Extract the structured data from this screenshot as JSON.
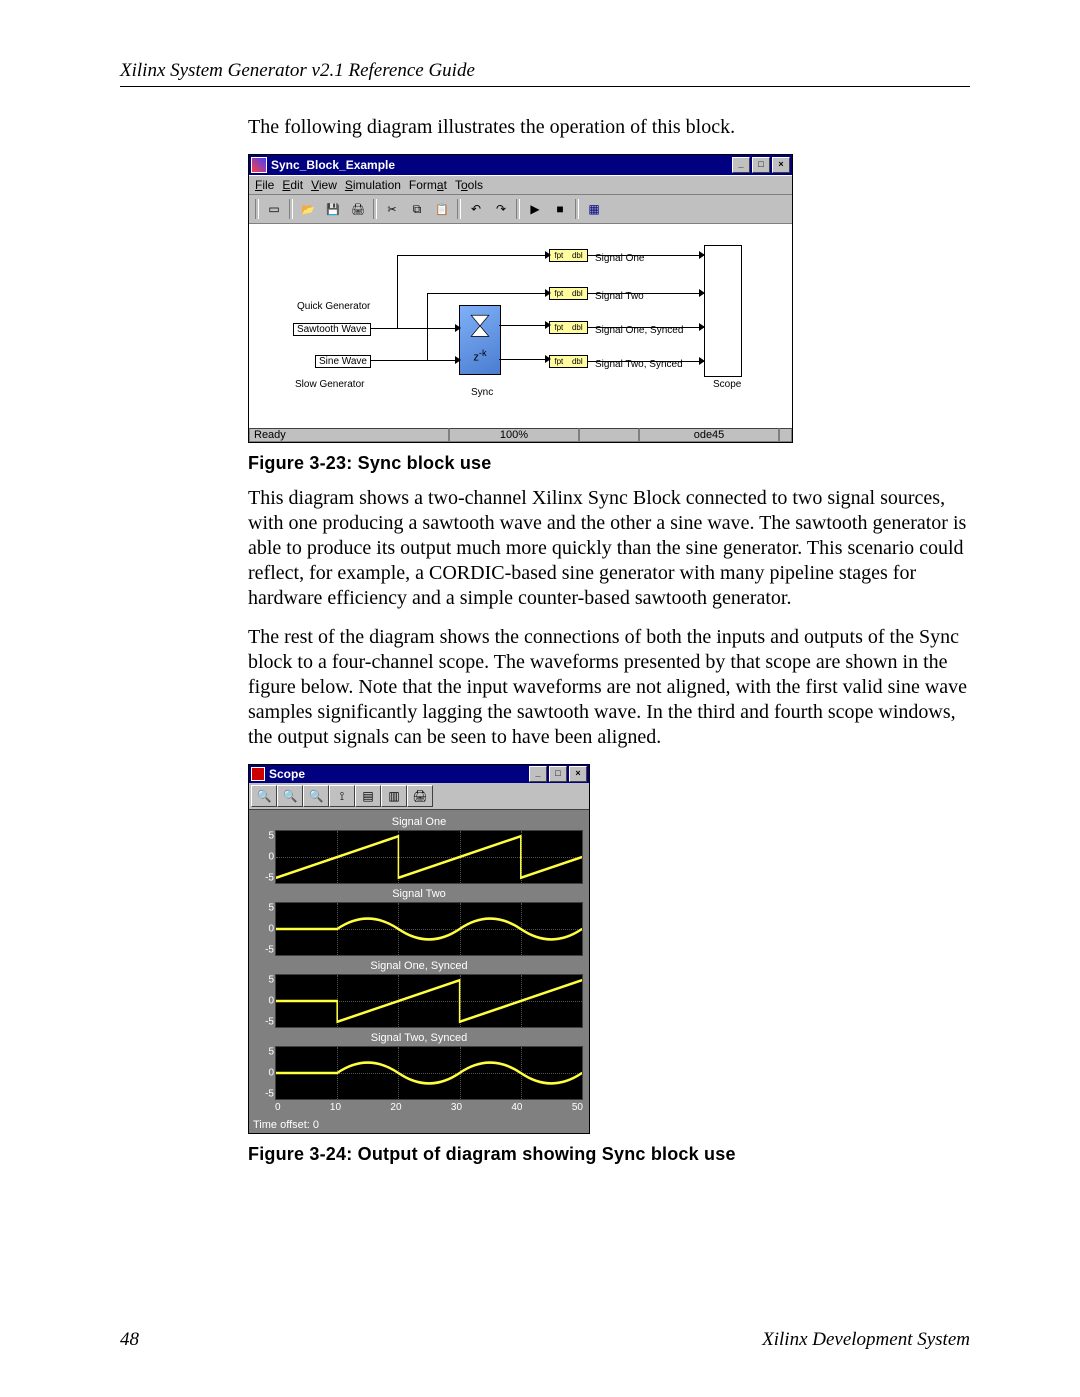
{
  "header": {
    "running_title": "Xilinx System Generator v2.1 Reference Guide"
  },
  "intro_para": "The following diagram illustrates the operation of this block.",
  "sim": {
    "title": "Sync_Block_Example",
    "menus": [
      "File",
      "Edit",
      "View",
      "Simulation",
      "Format",
      "Tools"
    ],
    "labels": {
      "quick_gen": "Quick Generator",
      "sawtooth": "Sawtooth Wave",
      "sine": "Sine Wave",
      "slow_gen": "Slow Generator",
      "sync": "Sync",
      "scope": "Scope",
      "sig1": "Signal One",
      "sig2": "Signal Two",
      "sig1s": "Signal One, Synced",
      "sig2s": "Signal Two, Synced",
      "zk": "z-k",
      "fpt_left": "fpt",
      "fpt_right": "dbl"
    },
    "status": {
      "ready": "Ready",
      "zoom": "100%",
      "solver": "ode45"
    }
  },
  "fig23_caption": "Figure 3-23:   Sync block use",
  "para2": "This diagram shows a two-channel Xilinx Sync Block connected to two signal sources, with one producing a sawtooth wave and the other a sine wave. The sawtooth generator is able to produce its output much more quickly than the sine generator. This scenario could reflect, for example, a CORDIC-based sine generator with many pipeline stages for hardware efficiency and a simple counter-based sawtooth generator.",
  "para3": "The rest of the diagram shows the connections of both the inputs and outputs of the Sync block to a four-channel scope. The waveforms presented by that scope are shown in the figure below. Note that the input waveforms are not aligned, with the first valid sine wave samples significantly lagging the sawtooth wave. In the third and fourth scope windows, the output signals can be seen to have been aligned.",
  "scope": {
    "title": "Scope",
    "plots": [
      "Signal One",
      "Signal Two",
      "Signal One, Synced",
      "Signal Two, Synced"
    ],
    "yticks": [
      "5",
      "0",
      "-5"
    ],
    "xticks": [
      "0",
      "10",
      "20",
      "30",
      "40",
      "50"
    ],
    "time_offset": "Time offset:   0"
  },
  "fig24_caption": "Figure 3-24:   Output of diagram showing Sync block use",
  "footer": {
    "page": "48",
    "system": "Xilinx Development System"
  },
  "chart_data": [
    {
      "type": "line",
      "title": "Signal One",
      "xlabel": "",
      "ylabel": "",
      "x": [
        0,
        5,
        10,
        15,
        20,
        20,
        25,
        30,
        35,
        40,
        40,
        45,
        50
      ],
      "y": [
        -4,
        -2,
        0,
        2,
        4,
        -4,
        -2,
        0,
        2,
        4,
        -4,
        -2,
        0
      ],
      "ylim": [
        -5,
        5
      ],
      "xlim": [
        0,
        50
      ]
    },
    {
      "type": "line",
      "title": "Signal Two",
      "x": [
        0,
        10,
        10,
        15,
        20,
        25,
        30,
        35,
        40,
        45,
        50
      ],
      "y": [
        0,
        0,
        0,
        3,
        0,
        -3,
        0,
        3,
        0,
        -3,
        0
      ],
      "ylim": [
        -5,
        5
      ],
      "xlim": [
        0,
        50
      ],
      "note": "first ~10 units are zero (delayed start), then sine"
    },
    {
      "type": "line",
      "title": "Signal One, Synced",
      "x": [
        0,
        10,
        10,
        15,
        20,
        25,
        30,
        30,
        35,
        40,
        45,
        50,
        50
      ],
      "y": [
        0,
        0,
        -4,
        -2,
        0,
        2,
        4,
        -4,
        -2,
        0,
        2,
        4,
        -4
      ],
      "ylim": [
        -5,
        5
      ],
      "xlim": [
        0,
        50
      ],
      "note": "sawtooth delayed to align with sine"
    },
    {
      "type": "line",
      "title": "Signal Two, Synced",
      "x": [
        0,
        10,
        10,
        15,
        20,
        25,
        30,
        35,
        40,
        45,
        50
      ],
      "y": [
        0,
        0,
        0,
        3,
        0,
        -3,
        0,
        3,
        0,
        -3,
        0
      ],
      "ylim": [
        -5,
        5
      ],
      "xlim": [
        0,
        50
      ]
    }
  ]
}
